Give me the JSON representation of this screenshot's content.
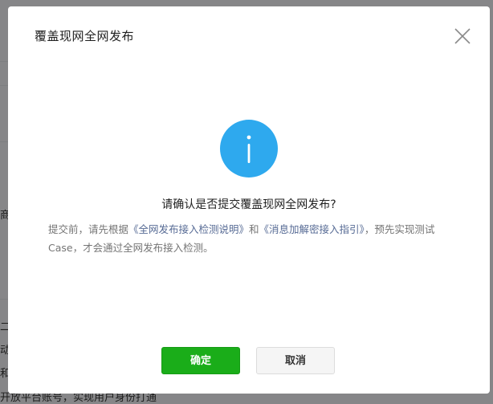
{
  "background": {
    "fragments": [
      "商",
      "二",
      "动",
      "和",
      "开放平台账号，实现用户身份打通"
    ]
  },
  "dialog": {
    "title": "覆盖现网全网发布",
    "question": "请确认是否提交覆盖现网全网发布?",
    "description": {
      "prefix": "提交前，请先根据",
      "link1": "《全网发布接入检测说明》",
      "middle": "和",
      "link2": "《消息加解密接入指引》",
      "suffix": "，预先实现测试Case，才会通过全网发布接入检测。"
    },
    "confirm_label": "确定",
    "cancel_label": "取消",
    "icon": "info-icon",
    "close_icon": "close-icon"
  },
  "colors": {
    "primary_green": "#1aad19",
    "info_blue": "#2ea9ee",
    "link": "#576b95"
  }
}
